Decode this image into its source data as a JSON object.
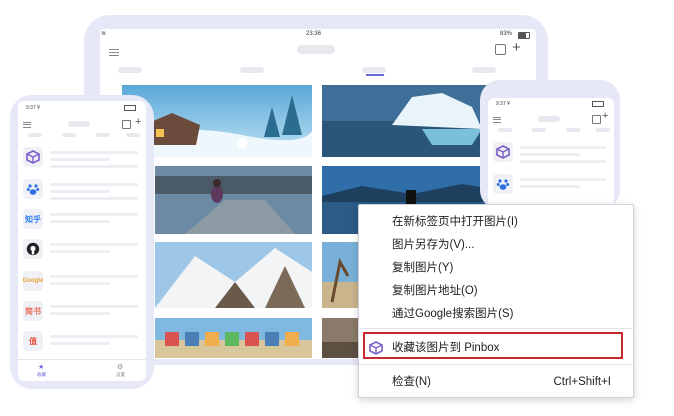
{
  "tablet": {
    "status": {
      "time": "23:36",
      "battery": "83%"
    },
    "icons": [
      "list-icon",
      "edit-icon",
      "plus-icon"
    ]
  },
  "phone_left": {
    "status": {
      "time": "9:37 ¥"
    },
    "apps": [
      {
        "name": "pinbox-icon",
        "text": "",
        "color": "#7b5ec9"
      },
      {
        "name": "baidu-paw-icon",
        "text": "",
        "color": "#2f6fe5"
      },
      {
        "name": "zhihu-logo",
        "text": "知乎",
        "color": "#2e7cf6"
      },
      {
        "name": "github-icon",
        "text": "",
        "color": "#222222"
      },
      {
        "name": "google-logo",
        "text": "Google",
        "color": "#e8a33a"
      },
      {
        "name": "jianshu-logo",
        "text": "简书",
        "color": "#ea6f5a"
      },
      {
        "name": "smzdm-logo",
        "text": "值",
        "color": "#e84e3b"
      }
    ],
    "bottom_tabs": [
      {
        "label": "收藏"
      },
      {
        "label": "设置"
      }
    ]
  },
  "phone_right": {
    "status": {
      "time": "9:37 ¥"
    },
    "apps": [
      {
        "name": "pinbox-icon",
        "color": "#7b5ec9"
      },
      {
        "name": "baidu-paw-icon",
        "color": "#2f6fe5"
      }
    ]
  },
  "context_menu": {
    "items": [
      {
        "label": "在新标签页中打开图片(I)"
      },
      {
        "label": "图片另存为(V)..."
      },
      {
        "label": "复制图片(Y)"
      },
      {
        "label": "复制图片地址(O)"
      },
      {
        "label": "通过Google搜索图片(S)"
      }
    ],
    "pinbox_item": {
      "label": "收藏该图片到 Pinbox",
      "icon": "pinbox-cube-icon",
      "highlight": "#c7282c"
    },
    "inspect": {
      "label": "检查(N)",
      "shortcut": "Ctrl+Shift+I"
    }
  },
  "colors": {
    "device_frame": "#e6e8f7",
    "accent_purple": "#7b5ec9"
  }
}
